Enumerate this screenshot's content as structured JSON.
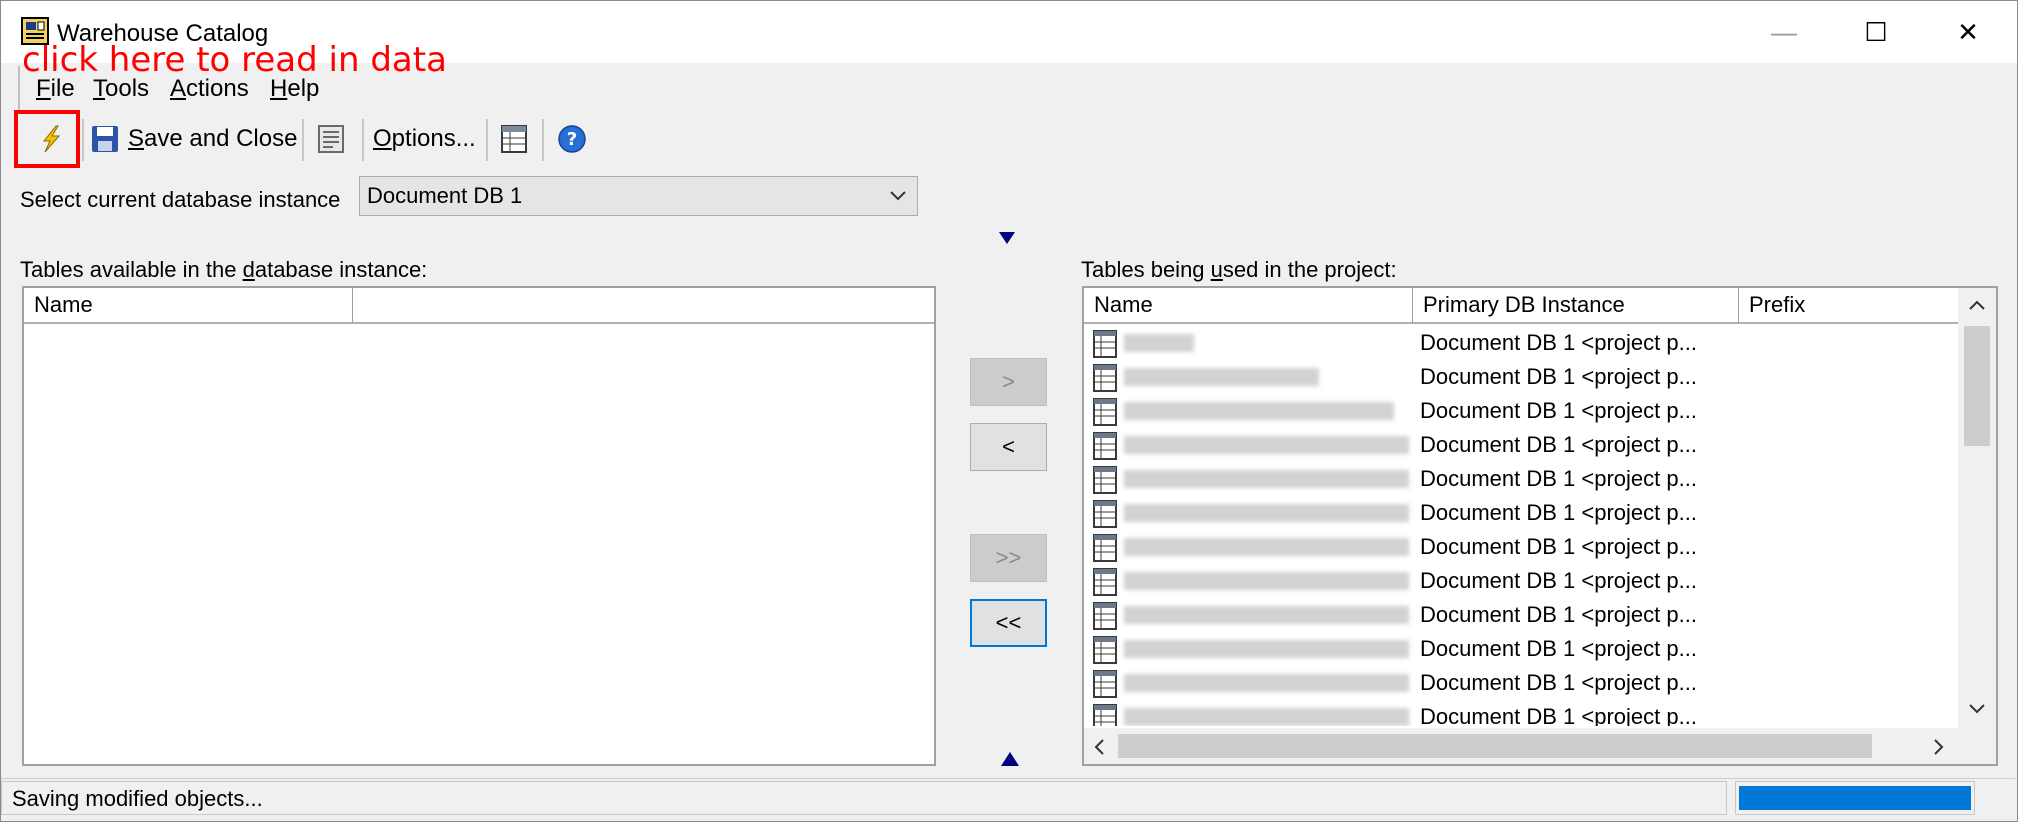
{
  "window": {
    "title": "Warehouse Catalog",
    "minimize": "—",
    "maximize": "☐",
    "close": "✕"
  },
  "annotation": {
    "text": "click here to read in data",
    "color": "#ff0000"
  },
  "menu": {
    "items": [
      {
        "label": "File",
        "hotkey": "F",
        "rest": "ile"
      },
      {
        "label": "Tools",
        "hotkey": "T",
        "rest": "ools"
      },
      {
        "label": "Actions",
        "hotkey": "A",
        "rest": "ctions"
      },
      {
        "label": "Help",
        "hotkey": "H",
        "rest": "elp"
      }
    ]
  },
  "toolbar": {
    "read_in_icon": "lightning-icon",
    "save_close": {
      "hotkey": "S",
      "rest": "ave and Close",
      "icon": "floppy-disk-icon"
    },
    "options": {
      "hotkey": "O",
      "rest": "ptions..."
    },
    "table_icon": "table-view-icon",
    "help_icon": "help-icon"
  },
  "db_select": {
    "label": "Select current database instance",
    "value": "Document DB 1"
  },
  "available": {
    "label_pre": "Tables available in the ",
    "label_hot": "d",
    "label_post": "atabase instance:",
    "columns": [
      "Name",
      ""
    ]
  },
  "used": {
    "label_pre": "Tables being ",
    "label_hot": "u",
    "label_post": "sed in the project:",
    "columns": [
      "Name",
      "Primary DB Instance",
      "Prefix"
    ],
    "rows": [
      {
        "instance": "Document DB 1 <project p..."
      },
      {
        "instance": "Document DB 1 <project p..."
      },
      {
        "instance": "Document DB 1 <project p..."
      },
      {
        "instance": "Document DB 1 <project p..."
      },
      {
        "instance": "Document DB 1 <project p..."
      },
      {
        "instance": "Document DB 1 <project p..."
      },
      {
        "instance": "Document DB 1 <project p..."
      },
      {
        "instance": "Document DB 1 <project p..."
      },
      {
        "instance": "Document DB 1 <project p..."
      },
      {
        "instance": "Document DB 1 <project p..."
      },
      {
        "instance": "Document DB 1 <project p..."
      },
      {
        "instance": "Document DB 1 <project p..."
      }
    ]
  },
  "move_buttons": {
    "add": ">",
    "remove": "<",
    "add_all": ">>",
    "remove_all": "<<"
  },
  "status": {
    "text": "Saving modified objects...",
    "progress_color": "#0078d7"
  },
  "colors": {
    "accent": "#0078d7",
    "highlight": "#ff0000",
    "arrow": "#000080"
  }
}
